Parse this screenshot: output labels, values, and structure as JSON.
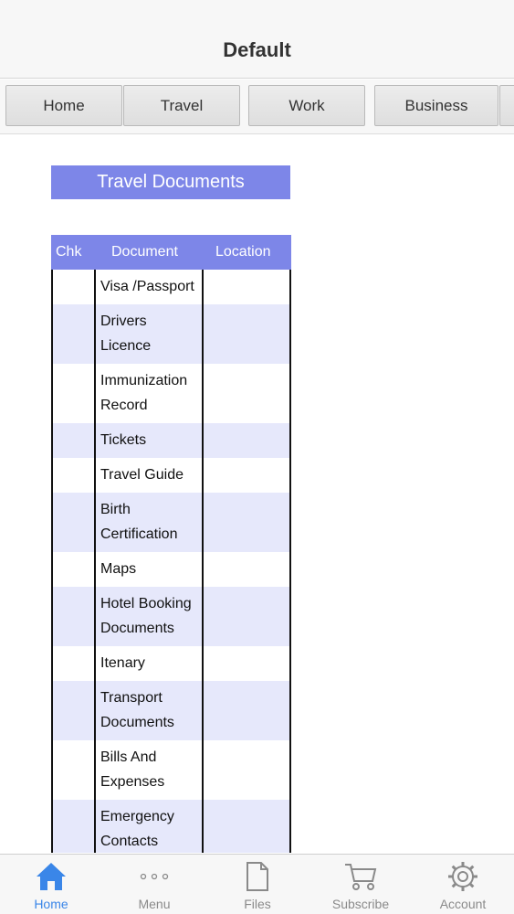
{
  "header": {
    "title": "Default"
  },
  "tabs": [
    {
      "label": "Home"
    },
    {
      "label": "Travel"
    },
    {
      "label": "Work"
    },
    {
      "label": "Business"
    }
  ],
  "section": {
    "title": "Travel Documents"
  },
  "table": {
    "headers": {
      "chk": "Chk",
      "document": "Document",
      "location": "Location"
    },
    "rows": [
      {
        "document": "Visa /Passport",
        "location": ""
      },
      {
        "document": "Drivers Licence",
        "location": ""
      },
      {
        "document": "Immunization Record",
        "location": ""
      },
      {
        "document": "Tickets",
        "location": ""
      },
      {
        "document": "Travel Guide",
        "location": ""
      },
      {
        "document": "Birth Certification",
        "location": ""
      },
      {
        "document": "Maps",
        "location": ""
      },
      {
        "document": "Hotel Booking Documents",
        "location": ""
      },
      {
        "document": "Itenary",
        "location": ""
      },
      {
        "document": "Transport Documents",
        "location": ""
      },
      {
        "document": "Bills And Expenses",
        "location": ""
      },
      {
        "document": "Emergency Contacts",
        "location": ""
      }
    ]
  },
  "bottom_nav": [
    {
      "label": "Home",
      "icon": "home-icon",
      "active": true
    },
    {
      "label": "Menu",
      "icon": "more-icon",
      "active": false
    },
    {
      "label": "Files",
      "icon": "file-icon",
      "active": false
    },
    {
      "label": "Subscribe",
      "icon": "cart-icon",
      "active": false
    },
    {
      "label": "Account",
      "icon": "gear-icon",
      "active": false
    }
  ],
  "colors": {
    "accent": "#7d86e8",
    "row_alt": "#e6e8fb",
    "active_tab": "#3a86e8",
    "inactive_tab": "#8a8a8a"
  }
}
